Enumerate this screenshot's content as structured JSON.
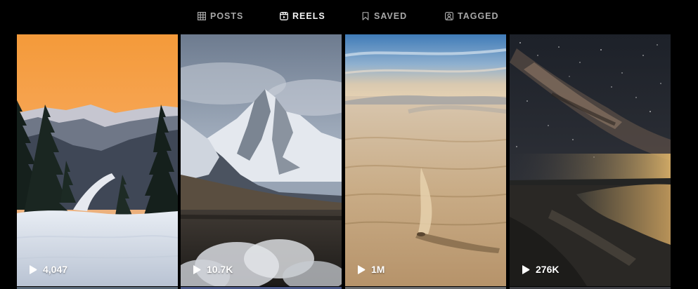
{
  "tabs": [
    {
      "label": "POSTS",
      "icon": "grid-icon",
      "active": false
    },
    {
      "label": "REELS",
      "icon": "reels-icon",
      "active": true
    },
    {
      "label": "SAVED",
      "icon": "bookmark-icon",
      "active": false
    },
    {
      "label": "TAGGED",
      "icon": "tagged-user-icon",
      "active": false
    }
  ],
  "reels": [
    {
      "scene": "snowy mountain road at sunset",
      "views": "4,047",
      "icon": "play-icon"
    },
    {
      "scene": "misty snow-capped mountain peak",
      "views": "10.7K",
      "icon": "play-icon"
    },
    {
      "scene": "white sand dunes at dusk",
      "views": "1M",
      "icon": "play-icon"
    },
    {
      "scene": "milky way over coastal lagoon",
      "views": "276K",
      "icon": "play-icon"
    }
  ],
  "colors": {
    "background": "#000000",
    "tab_inactive": "#a8a8a8",
    "tab_active": "#f5f5f5",
    "overlay_text": "#ffffff"
  }
}
